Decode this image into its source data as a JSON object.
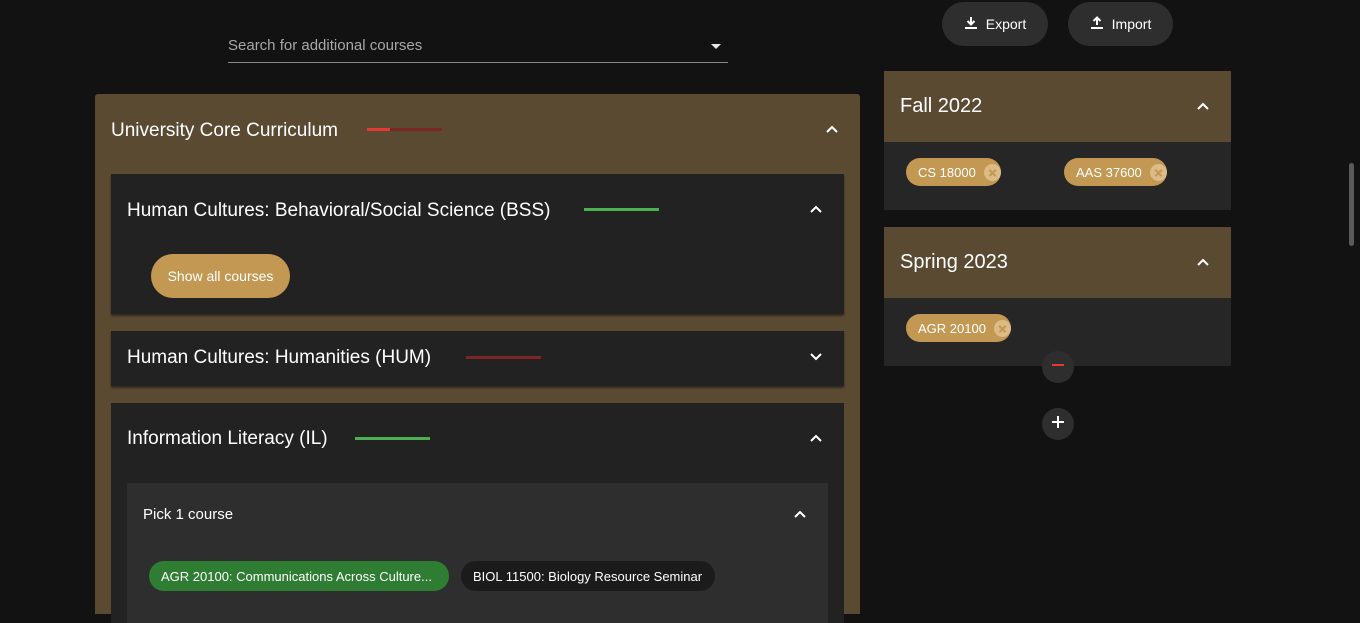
{
  "search": {
    "placeholder": "Search for additional courses"
  },
  "toolbar": {
    "export_label": "Export",
    "import_label": "Import"
  },
  "core": {
    "title": "University Core Curriculum",
    "progress": 0.3,
    "colors": {
      "complete": "#4caf50",
      "incomplete": "#e53935",
      "track_bad": "#7a2626"
    },
    "sections": [
      {
        "title": "Human Cultures: Behavioral/Social Science (BSS)",
        "status": "complete",
        "expanded": true,
        "show_all_label": "Show all courses"
      },
      {
        "title": "Human Cultures: Humanities (HUM)",
        "status": "incomplete",
        "expanded": false
      },
      {
        "title": "Information Literacy (IL)",
        "status": "complete",
        "expanded": true,
        "group": {
          "title": "Pick 1 course",
          "courses": [
            {
              "label": "AGR 20100: Communications Across Culture...",
              "selected": true
            },
            {
              "label": "BIOL 11500: Biology Resource Seminar",
              "selected": false
            }
          ]
        }
      }
    ]
  },
  "semesters": [
    {
      "title": "Fall 2022",
      "courses": [
        "CS 18000",
        "AAS 37600"
      ]
    },
    {
      "title": "Spring 2023",
      "courses": [
        "AGR 20100"
      ]
    }
  ],
  "icons": {
    "export": "download-icon",
    "import": "upload-icon",
    "remove_semester": "minus-icon",
    "add_semester": "plus-icon"
  }
}
